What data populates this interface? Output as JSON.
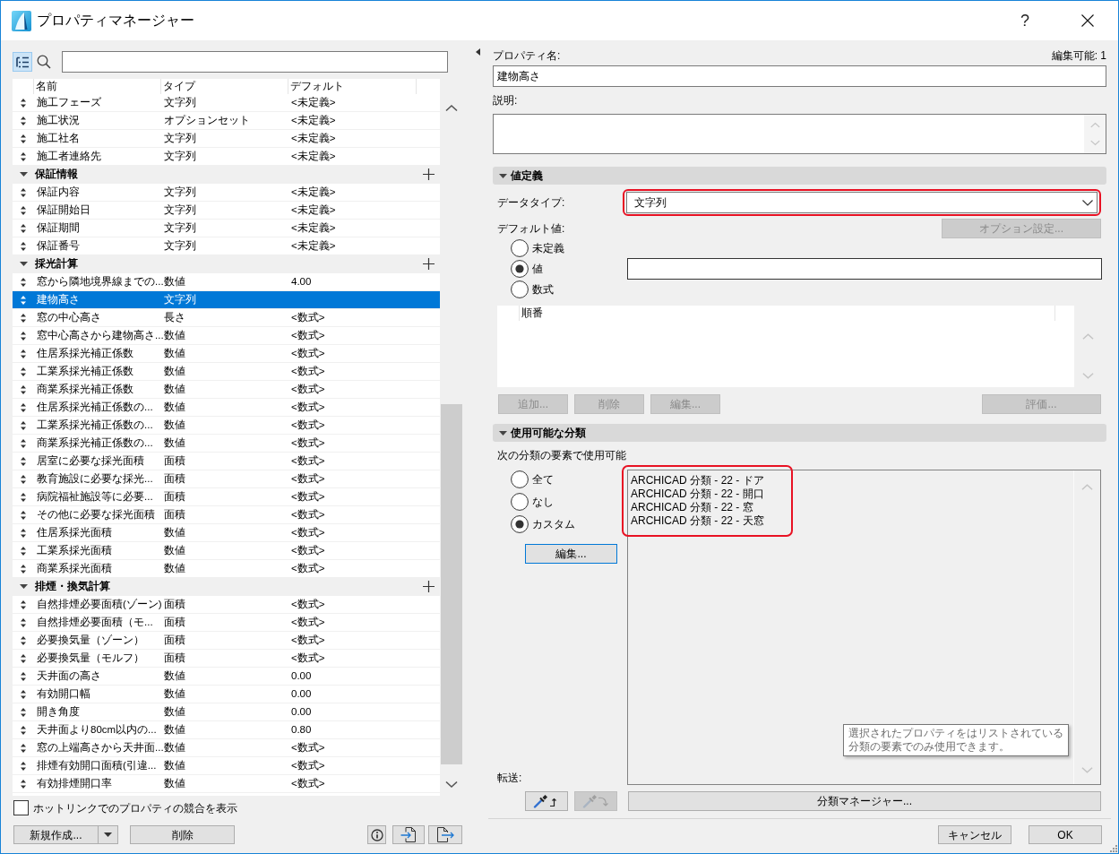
{
  "window": {
    "title": "プロパティマネージャー",
    "help": "?"
  },
  "toolbar": {
    "view_toggle": {
      "selected": true
    }
  },
  "property_table": {
    "columns": [
      "名前",
      "タイプ",
      "デフォルト"
    ],
    "items": [
      {
        "kind": "property",
        "name": "施工フェーズ",
        "type": "文字列",
        "default": "<未定義>",
        "selected": false
      },
      {
        "kind": "property",
        "name": "施工状況",
        "type": "オプションセット",
        "default": "<未定義>",
        "selected": false
      },
      {
        "kind": "property",
        "name": "施工社名",
        "type": "文字列",
        "default": "<未定義>",
        "selected": false
      },
      {
        "kind": "property",
        "name": "施工者連絡先",
        "type": "文字列",
        "default": "<未定義>",
        "selected": false
      },
      {
        "kind": "group",
        "name": "保証情報",
        "expanded": true,
        "selected": false,
        "children": [
          {
            "kind": "property",
            "name": "保証内容",
            "type": "文字列",
            "default": "<未定義>",
            "selected": false
          },
          {
            "kind": "property",
            "name": "保証開始日",
            "type": "文字列",
            "default": "<未定義>",
            "selected": false
          },
          {
            "kind": "property",
            "name": "保証期間",
            "type": "文字列",
            "default": "<未定義>",
            "selected": false
          },
          {
            "kind": "property",
            "name": "保証番号",
            "type": "文字列",
            "default": "<未定義>",
            "selected": false
          }
        ]
      },
      {
        "kind": "group",
        "name": "採光計算",
        "expanded": true,
        "selected": false,
        "children": [
          {
            "kind": "property",
            "name": "窓から隣地境界線までの...",
            "type": "数値",
            "default": "4.00",
            "selected": false
          },
          {
            "kind": "property",
            "name": "建物高さ",
            "type": "文字列",
            "selected": true
          },
          {
            "kind": "property",
            "name": "窓の中心高さ",
            "type": "長さ",
            "default": "<数式>",
            "selected": false
          },
          {
            "kind": "property",
            "name": "窓中心高さから建物高さ...",
            "type": "数値",
            "default": "<数式>",
            "selected": false
          },
          {
            "kind": "property",
            "name": "住居系採光補正係数",
            "type": "数値",
            "default": "<数式>",
            "selected": false
          },
          {
            "kind": "property",
            "name": "工業系採光補正係数",
            "type": "数値",
            "default": "<数式>",
            "selected": false
          },
          {
            "kind": "property",
            "name": "商業系採光補正係数",
            "type": "数値",
            "default": "<数式>",
            "selected": false
          },
          {
            "kind": "property",
            "name": "住居系採光補正係数の...",
            "type": "数値",
            "default": "<数式>",
            "selected": false
          },
          {
            "kind": "property",
            "name": "工業系採光補正係数の...",
            "type": "数値",
            "default": "<数式>",
            "selected": false
          },
          {
            "kind": "property",
            "name": "商業系採光補正係数の...",
            "type": "数値",
            "default": "<数式>",
            "selected": false
          },
          {
            "kind": "property",
            "name": "居室に必要な採光面積",
            "type": "面積",
            "default": "<数式>",
            "selected": false
          },
          {
            "kind": "property",
            "name": "教育施設に必要な採光...",
            "type": "面積",
            "default": "<数式>",
            "selected": false
          },
          {
            "kind": "property",
            "name": "病院福祉施設等に必要...",
            "type": "面積",
            "default": "<数式>",
            "selected": false
          },
          {
            "kind": "property",
            "name": "その他に必要な採光面積",
            "type": "面積",
            "default": "<数式>",
            "selected": false
          },
          {
            "kind": "property",
            "name": "住居系採光面積",
            "type": "数値",
            "default": "<数式>",
            "selected": false
          },
          {
            "kind": "property",
            "name": "工業系採光面積",
            "type": "数値",
            "default": "<数式>",
            "selected": false
          },
          {
            "kind": "property",
            "name": "商業系採光面積",
            "type": "数値",
            "default": "<数式>",
            "selected": false
          }
        ]
      },
      {
        "kind": "group",
        "name": "排煙・換気計算",
        "expanded": true,
        "selected": false,
        "children": [
          {
            "kind": "property",
            "name": "自然排煙必要面積(ゾーン)",
            "type": "面積",
            "default": "<数式>",
            "selected": false
          },
          {
            "kind": "property",
            "name": "自然排煙必要面積（モ...",
            "type": "面積",
            "default": "<数式>",
            "selected": false
          },
          {
            "kind": "property",
            "name": "必要換気量（ゾーン）",
            "type": "面積",
            "default": "<数式>",
            "selected": false
          },
          {
            "kind": "property",
            "name": "必要換気量（モルフ）",
            "type": "面積",
            "default": "<数式>",
            "selected": false
          },
          {
            "kind": "property",
            "name": "天井面の高さ",
            "type": "数値",
            "default": "0.00",
            "selected": false
          },
          {
            "kind": "property",
            "name": "有効開口幅",
            "type": "数値",
            "default": "0.00",
            "selected": false
          },
          {
            "kind": "property",
            "name": "開き角度",
            "type": "数値",
            "default": "0.00",
            "selected": false
          },
          {
            "kind": "property",
            "name": "天井面より80cm以内の...",
            "type": "数値",
            "default": "0.80",
            "selected": false
          },
          {
            "kind": "property",
            "name": "窓の上端高さから天井面...",
            "type": "数値",
            "default": "<数式>",
            "selected": false
          },
          {
            "kind": "property",
            "name": "排煙有効開口面積(引違...",
            "type": "数値",
            "default": "<数式>",
            "selected": false
          },
          {
            "kind": "property",
            "name": "有効排煙開口率",
            "type": "数値",
            "default": "<数式>",
            "selected": false
          }
        ]
      }
    ]
  },
  "hotlink_option": {
    "label": "ホットリンクでのプロパティの競合を表示",
    "checked": false
  },
  "left_buttons": [
    {
      "kind": "split",
      "label": "新規作成..."
    },
    {
      "kind": "text",
      "label": "削除"
    },
    {
      "kind": "info"
    },
    {
      "kind": "import"
    },
    {
      "kind": "export"
    }
  ],
  "property_name": {
    "label": "プロパティ名:",
    "value": "建物高さ"
  },
  "editable": "編集可能: 1",
  "description": {
    "label": "説明:"
  },
  "value_definition": {
    "title": "値定義",
    "expanded": true,
    "data_type": {
      "label": "データタイプ:",
      "value": "文字列",
      "highlighted": true
    },
    "default_value": {
      "label": "デフォルト値:",
      "options_button": {
        "label": "オプション設定...",
        "disabled": true
      },
      "options": [
        {
          "label": "未定義",
          "selected": false
        },
        {
          "label": "値",
          "selected": true
        },
        {
          "label": "数式",
          "selected": false
        }
      ]
    },
    "order_list": {
      "column": "順番"
    },
    "buttons": [
      {
        "label": "追加...",
        "disabled": true
      },
      {
        "label": "削除",
        "disabled": true
      },
      {
        "label": "編集...",
        "disabled": true
      },
      {
        "label": "評価...",
        "disabled": true
      }
    ]
  },
  "available_classifications": {
    "title": "使用可能な分類",
    "expanded": true,
    "caption": "次の分類の要素で使用可能",
    "options": [
      {
        "label": "全て",
        "selected": false
      },
      {
        "label": "なし",
        "selected": false
      },
      {
        "label": "カスタム",
        "selected": true
      }
    ],
    "edit_button": {
      "label": "編集...",
      "focused": true
    },
    "list": {
      "highlighted": true,
      "items": [
        "ARCHICAD 分類 - 22 - ドア",
        "ARCHICAD 分類 - 22 - 開口",
        "ARCHICAD 分類 - 22 - 窓",
        "ARCHICAD 分類 - 22 - 天窓"
      ]
    },
    "tooltip": [
      "選択されたプロパティをはリストされている",
      "分類の要素でのみ使用できます。"
    ]
  },
  "transfer": {
    "label": "転送:",
    "buttons": [
      {
        "kind": "pick",
        "disabled": false
      },
      {
        "kind": "inject",
        "disabled": true
      }
    ]
  },
  "classification_manager_button": {
    "label": "分類マネージャー..."
  },
  "footer_buttons": [
    {
      "label": "キャンセル"
    },
    {
      "label": "OK"
    }
  ]
}
